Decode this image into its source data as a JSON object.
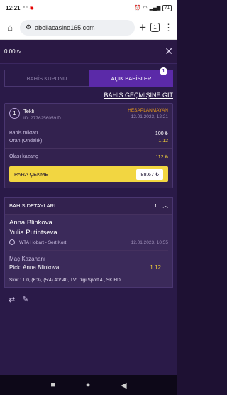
{
  "statusbar": {
    "time": "12:21",
    "battery": "71"
  },
  "browser": {
    "url": "abellacasino165.com",
    "tab_count": "1"
  },
  "topbar": {
    "balance": "0.00 ₺"
  },
  "tabs": [
    {
      "label": "BAHİS KUPONU"
    },
    {
      "label": "AÇIK BAHİSLER",
      "badge": "1"
    }
  ],
  "history_link": "BAHİS GEÇMİŞİNE GİT",
  "bet": {
    "number": "1",
    "type": "Tekli",
    "id": "ID: 2776256059",
    "status": "HESAPLANMAYAN",
    "date": "12.01.2023, 12:21",
    "stake_label": "Bahis miktarı...",
    "stake_value": "100 ₺",
    "odds_label": "Oran (Ondalık)",
    "odds_value": "1.12",
    "potential_label": "Olası kazanç",
    "potential_value": "112 ₺",
    "cashout_label": "PARA ÇEKME",
    "cashout_amount": "88.67 ₺"
  },
  "details": {
    "title": "BAHİS DETAYLARI",
    "count": "1",
    "player1": "Anna Blinkova",
    "player2": "Yulia Putintseva",
    "league": "WTA Hobart - Sert Kort",
    "event_date": "12.01.2023, 10:55",
    "market": "Maç Kazananı",
    "pick": "Pick:  Anna Blinkova",
    "pick_odds": "1.12",
    "score": "Skor : 1:0, (6:3), (5:4) 40*:40, TV: Digi Sport 4 , SK HD"
  },
  "colors": {
    "accent": "#5b2aa8",
    "cashout": "#f2d641",
    "status": "#e89a1a",
    "odds": "#f3d13a"
  }
}
